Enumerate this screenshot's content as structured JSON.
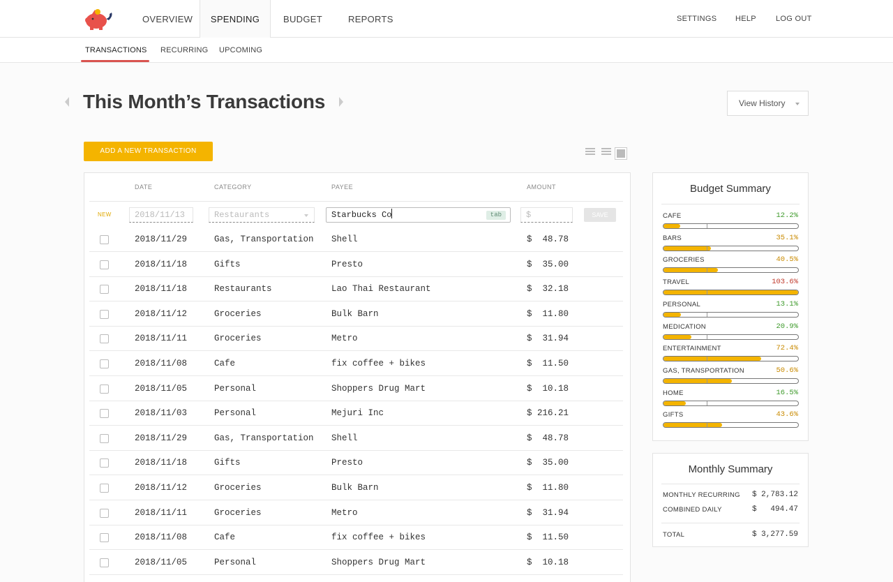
{
  "nav": {
    "items": [
      "OVERVIEW",
      "SPENDING",
      "BUDGET",
      "REPORTS"
    ],
    "right": [
      "SETTINGS",
      "HELP",
      "LOG OUT"
    ]
  },
  "subnav": {
    "items": [
      "TRANSACTIONS",
      "RECURRING",
      "UPCOMING"
    ]
  },
  "page": {
    "title": "This Month’s Transactions",
    "view_history": "View History",
    "add_button": "ADD A NEW TRANSACTION"
  },
  "table": {
    "headers": [
      "DATE",
      "CATEGORY",
      "PAYEE",
      "AMOUNT"
    ],
    "new_row": {
      "label": "NEW",
      "date_placeholder": "2018/11/13",
      "category_placeholder": "Restaurants",
      "payee_value": "Starbucks Co",
      "payee_hint": "tab",
      "amount_placeholder": "$",
      "save_label": "SAVE"
    },
    "rows": [
      {
        "date": "2018/11/29",
        "category": "Gas, Transportation",
        "payee": "Shell",
        "amount": "$  48.78"
      },
      {
        "date": "2018/11/18",
        "category": "Gifts",
        "payee": "Presto",
        "amount": "$  35.00"
      },
      {
        "date": "2018/11/18",
        "category": "Restaurants",
        "payee": "Lao Thai Restaurant",
        "amount": "$  32.18"
      },
      {
        "date": "2018/11/12",
        "category": "Groceries",
        "payee": "Bulk Barn",
        "amount": "$  11.80"
      },
      {
        "date": "2018/11/11",
        "category": "Groceries",
        "payee": "Metro",
        "amount": "$  31.94"
      },
      {
        "date": "2018/11/08",
        "category": "Cafe",
        "payee": "fix coffee + bikes",
        "amount": "$  11.50"
      },
      {
        "date": "2018/11/05",
        "category": "Personal",
        "payee": "Shoppers Drug Mart",
        "amount": "$  10.18"
      },
      {
        "date": "2018/11/03",
        "category": "Personal",
        "payee": "Mejuri Inc",
        "amount": "$ 216.21"
      },
      {
        "date": "2018/11/29",
        "category": "Gas, Transportation",
        "payee": "Shell",
        "amount": "$  48.78"
      },
      {
        "date": "2018/11/18",
        "category": "Gifts",
        "payee": "Presto",
        "amount": "$  35.00"
      },
      {
        "date": "2018/11/12",
        "category": "Groceries",
        "payee": "Bulk Barn",
        "amount": "$  11.80"
      },
      {
        "date": "2018/11/11",
        "category": "Groceries",
        "payee": "Metro",
        "amount": "$  31.94"
      },
      {
        "date": "2018/11/08",
        "category": "Cafe",
        "payee": "fix coffee + bikes",
        "amount": "$  11.50"
      },
      {
        "date": "2018/11/05",
        "category": "Personal",
        "payee": "Shoppers Drug Mart",
        "amount": "$  10.18"
      }
    ]
  },
  "budget_summary": {
    "title": "Budget Summary",
    "items": [
      {
        "label": "CAFE",
        "pct": "12.2%",
        "value": 0.122,
        "color": "#3e9a2b"
      },
      {
        "label": "BARS",
        "pct": "35.1%",
        "value": 0.351,
        "color": "#c98a00"
      },
      {
        "label": "GROCERIES",
        "pct": "40.5%",
        "value": 0.405,
        "color": "#c98a00"
      },
      {
        "label": "TRAVEL",
        "pct": "103.6%",
        "value": 1.036,
        "color": "#c0392b"
      },
      {
        "label": "PERSONAL",
        "pct": "13.1%",
        "value": 0.131,
        "color": "#3e9a2b"
      },
      {
        "label": "MEDICATION",
        "pct": "20.9%",
        "value": 0.209,
        "color": "#3e9a2b"
      },
      {
        "label": "ENTERTAINMENT",
        "pct": "72.4%",
        "value": 0.724,
        "color": "#c98a00"
      },
      {
        "label": "GAS, TRANSPORTATION",
        "pct": "50.6%",
        "value": 0.506,
        "color": "#c98a00"
      },
      {
        "label": "HOME",
        "pct": "16.5%",
        "value": 0.165,
        "color": "#3e9a2b"
      },
      {
        "label": "GIFTS",
        "pct": "43.6%",
        "value": 0.436,
        "color": "#c98a00"
      }
    ]
  },
  "monthly_summary": {
    "title": "Monthly Summary",
    "items": [
      {
        "label": "MONTHLY RECURRING",
        "value": "$ 2,783.12"
      },
      {
        "label": "COMBINED DAILY",
        "value": "$   494.47"
      }
    ],
    "total": {
      "label": "TOTAL",
      "value": "$ 3,277.59"
    }
  },
  "colors": {
    "accent": "#f4b400",
    "active_tab_underline": "#d9534f",
    "logo": "#e8514b"
  }
}
